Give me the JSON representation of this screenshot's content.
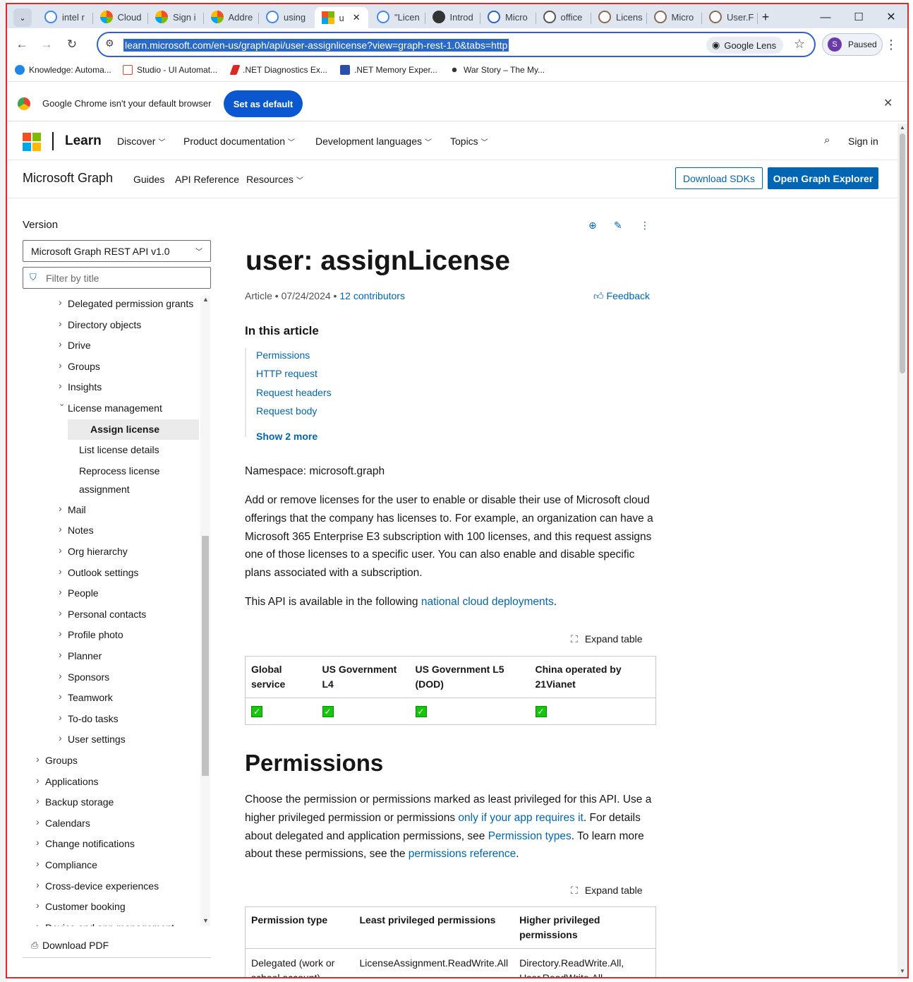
{
  "browser": {
    "tabs": [
      {
        "label": "intel r",
        "icon": "google-icon"
      },
      {
        "label": "Cloud",
        "icon": "ms365-icon"
      },
      {
        "label": "Sign i",
        "icon": "ms365-icon"
      },
      {
        "label": "Addre",
        "icon": "ms365-icon"
      },
      {
        "label": "using",
        "icon": "google-icon"
      },
      {
        "label": "u",
        "icon": "microsoft-icon"
      },
      {
        "label": "\"Licen",
        "icon": "google-icon"
      },
      {
        "label": "Introd",
        "icon": "wordpress-icon"
      },
      {
        "label": "Micro",
        "icon": "x-icon"
      },
      {
        "label": "office",
        "icon": "search-icon"
      },
      {
        "label": "Licens",
        "icon": "owl-icon"
      },
      {
        "label": "Micro",
        "icon": "owl-icon"
      },
      {
        "label": "User.F",
        "icon": "owl-icon"
      }
    ],
    "url": "learn.microsoft.com/en-us/graph/api/user-assignlicense?view=graph-rest-1.0&tabs=http",
    "google_lens": "Google Lens",
    "profile": {
      "initial": "S",
      "status": "Paused"
    },
    "bookmarks": [
      "Knowledge: Automa...",
      "Studio - UI Automat...",
      ".NET Diagnostics Ex...",
      ".NET Memory Exper...",
      "War Story – The My..."
    ],
    "infobar": {
      "message": "Google Chrome isn't your default browser",
      "button": "Set as default"
    }
  },
  "site": {
    "brand": "Learn",
    "menus": [
      "Discover",
      "Product documentation",
      "Development languages",
      "Topics"
    ],
    "sign_in": "Sign in",
    "product": "Microsoft Graph",
    "subnav": [
      "Guides",
      "API Reference",
      "Resources"
    ],
    "download_sdks": "Download SDKs",
    "open_explorer": "Open Graph Explorer"
  },
  "sidebar": {
    "version_label": "Version",
    "version_value": "Microsoft Graph REST API v1.0",
    "filter_placeholder": "Filter by title",
    "download_pdf": "Download PDF",
    "toc": [
      {
        "label": "Delegated permission grants",
        "level": 1,
        "state": "collapsed"
      },
      {
        "label": "Directory objects",
        "level": 1,
        "state": "collapsed"
      },
      {
        "label": "Drive",
        "level": 1,
        "state": "collapsed"
      },
      {
        "label": "Groups",
        "level": 1,
        "state": "collapsed"
      },
      {
        "label": "Insights",
        "level": 1,
        "state": "collapsed"
      },
      {
        "label": "License management",
        "level": 1,
        "state": "expanded"
      },
      {
        "label": "Assign license",
        "level": 2,
        "state": "selected"
      },
      {
        "label": "List license details",
        "level": 2,
        "state": "leaf"
      },
      {
        "label": "Reprocess license",
        "label2": "assignment",
        "level": 2,
        "state": "leaf"
      },
      {
        "label": "Mail",
        "level": 1,
        "state": "collapsed"
      },
      {
        "label": "Notes",
        "level": 1,
        "state": "collapsed"
      },
      {
        "label": "Org hierarchy",
        "level": 1,
        "state": "collapsed"
      },
      {
        "label": "Outlook settings",
        "level": 1,
        "state": "collapsed"
      },
      {
        "label": "People",
        "level": 1,
        "state": "collapsed"
      },
      {
        "label": "Personal contacts",
        "level": 1,
        "state": "collapsed"
      },
      {
        "label": "Profile photo",
        "level": 1,
        "state": "collapsed"
      },
      {
        "label": "Planner",
        "level": 1,
        "state": "collapsed"
      },
      {
        "label": "Sponsors",
        "level": 1,
        "state": "collapsed"
      },
      {
        "label": "Teamwork",
        "level": 1,
        "state": "collapsed"
      },
      {
        "label": "To-do tasks",
        "level": 1,
        "state": "collapsed"
      },
      {
        "label": "User settings",
        "level": 1,
        "state": "collapsed"
      },
      {
        "label": "Groups",
        "level": 0,
        "state": "collapsed"
      },
      {
        "label": "Applications",
        "level": 0,
        "state": "collapsed"
      },
      {
        "label": "Backup storage",
        "level": 0,
        "state": "collapsed"
      },
      {
        "label": "Calendars",
        "level": 0,
        "state": "collapsed"
      },
      {
        "label": "Change notifications",
        "level": 0,
        "state": "collapsed"
      },
      {
        "label": "Compliance",
        "level": 0,
        "state": "collapsed"
      },
      {
        "label": "Cross-device experiences",
        "level": 0,
        "state": "collapsed"
      },
      {
        "label": "Customer booking",
        "level": 0,
        "state": "collapsed"
      },
      {
        "label": "Device and app management",
        "level": 0,
        "state": "collapsed"
      }
    ]
  },
  "article": {
    "title": "user: assignLicense",
    "meta_type": "Article",
    "date": "07/24/2024",
    "contributors": "12 contributors",
    "feedback": "Feedback",
    "in_this_article": "In this article",
    "toc_links": [
      "Permissions",
      "HTTP request",
      "Request headers",
      "Request body"
    ],
    "show_more": "Show 2 more",
    "namespace": "Namespace: microsoft.graph",
    "description": "Add or remove licenses for the user to enable or disable their use of Microsoft cloud offerings that the company has licenses to. For example, an organization can have a Microsoft 365 Enterprise E3 subscription with 100 licenses, and this request assigns one of those licenses to a specific user. You can also enable and disable specific plans associated with a subscription.",
    "availability_prefix": "This API is available in the following ",
    "availability_link": "national cloud deployments",
    "availability_suffix": ".",
    "expand_table": "Expand table",
    "cloud_table": {
      "headers": [
        "Global service",
        "US Government L4",
        "US Government L5 (DOD)",
        "China operated by 21Vianet"
      ],
      "row": [
        "✓",
        "✓",
        "✓",
        "✓"
      ]
    },
    "permissions_heading": "Permissions",
    "permissions_p1": "Choose the permission or permissions marked as least privileged for this API. Use a higher privileged permission or permissions ",
    "permissions_link1": "only if your app requires it",
    "permissions_p2": ". For details about delegated and application permissions, see ",
    "permissions_link2": "Permission types",
    "permissions_p3": ". To learn more about these permissions, see the ",
    "permissions_link3": "permissions reference",
    "permissions_p4": ".",
    "perm_table": {
      "headers": [
        "Permission type",
        "Least privileged permissions",
        "Higher privileged permissions"
      ],
      "row": [
        "Delegated (work or school account)",
        "LicenseAssignment.ReadWrite.All",
        "Directory.ReadWrite.All, User.ReadWrite.All"
      ]
    }
  }
}
